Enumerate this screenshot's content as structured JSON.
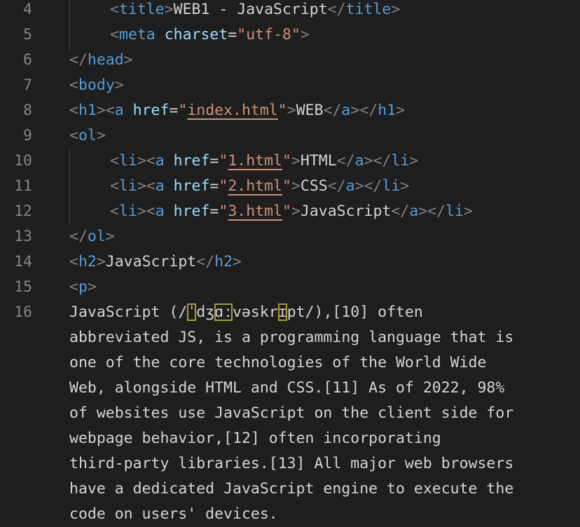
{
  "line_numbers": [
    "4",
    "5",
    "6",
    "7",
    "8",
    "9",
    "10",
    "11",
    "12",
    "13",
    "14",
    "15",
    "16"
  ],
  "lines": {
    "l4": {
      "open": "title",
      "text": "WEB1 - JavaScript",
      "close": "title"
    },
    "l5": {
      "tag": "meta",
      "attr": "charset",
      "value": "utf-8"
    },
    "l6": {
      "close": "head"
    },
    "l7": {
      "open": "body"
    },
    "l8": {
      "h": "h1",
      "a": "a",
      "attr": "href",
      "value": "index.html",
      "text": "WEB"
    },
    "l9": {
      "open": "ol"
    },
    "l10": {
      "li": "li",
      "a": "a",
      "attr": "href",
      "value": "1.html",
      "text": "HTML"
    },
    "l11": {
      "li": "li",
      "a": "a",
      "attr": "href",
      "value": "2.html",
      "text": "CSS"
    },
    "l12": {
      "li": "li",
      "a": "a",
      "attr": "href",
      "value": "3.html",
      "text": "JavaScript"
    },
    "l13": {
      "close": "ol"
    },
    "l14": {
      "h": "h2",
      "text": "JavaScript"
    },
    "l15": {
      "open": "p"
    }
  },
  "paragraph": {
    "l1_a": "JavaScript (/",
    "l1_b": "ˈ",
    "l1_c": "dʒ",
    "l1_d": "ɑː",
    "l1_e": "vəskr",
    "l1_f": "ɪ",
    "l1_g": "pt/),[10] often",
    "l2": "abbreviated JS, is a programming language that is",
    "l3": "one of the core technologies of the World Wide",
    "l4": "Web, alongside HTML and CSS.[11] As of 2022, 98%",
    "l5": "of websites use JavaScript on the client side for",
    "l6": "webpage behavior,[12] often incorporating",
    "l7": "third-party libraries.[13] All major web browsers",
    "l8": "have a dedicated JavaScript engine to execute the",
    "l9": "code on users' devices."
  }
}
